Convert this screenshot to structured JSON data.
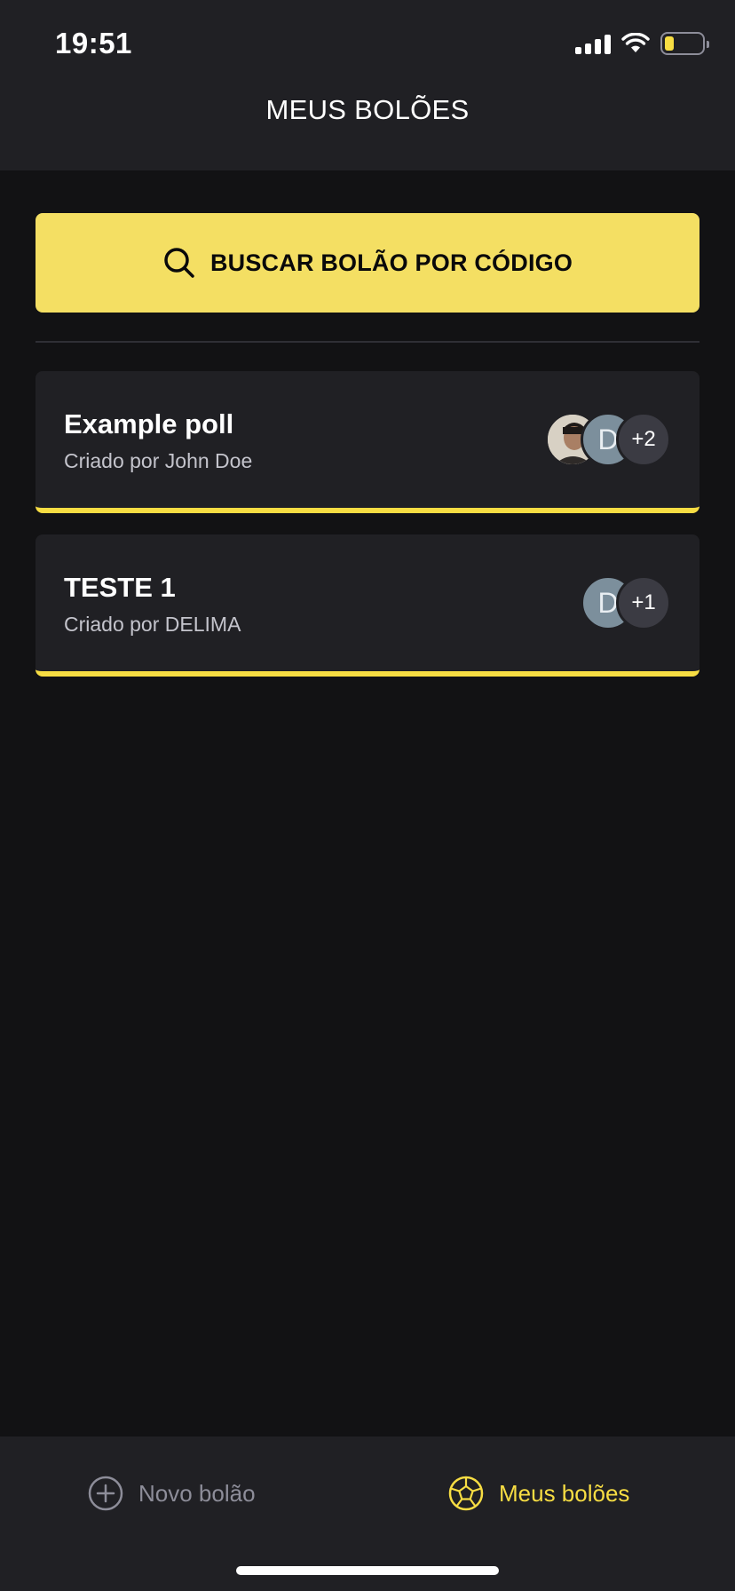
{
  "status_bar": {
    "time": "19:51"
  },
  "header": {
    "title": "MEUS BOLÕES"
  },
  "search": {
    "label": "BUSCAR BOLÃO POR CÓDIGO",
    "icon": "search-icon"
  },
  "polls": [
    {
      "title": "Example poll",
      "subtitle": "Criado por John Doe",
      "avatars": [
        "photo",
        "D"
      ],
      "extra_count": "+2"
    },
    {
      "title": "TESTE 1",
      "subtitle": "Criado por DELIMA",
      "avatars": [
        "D"
      ],
      "extra_count": "+1"
    }
  ],
  "tab_bar": {
    "new_poll": "Novo bolão",
    "my_polls": "Meus bolões",
    "active_tab": "my_polls"
  },
  "colors": {
    "accent": "#F7DD43",
    "background": "#121214",
    "surface": "#202024",
    "muted": "#8D8D99"
  }
}
